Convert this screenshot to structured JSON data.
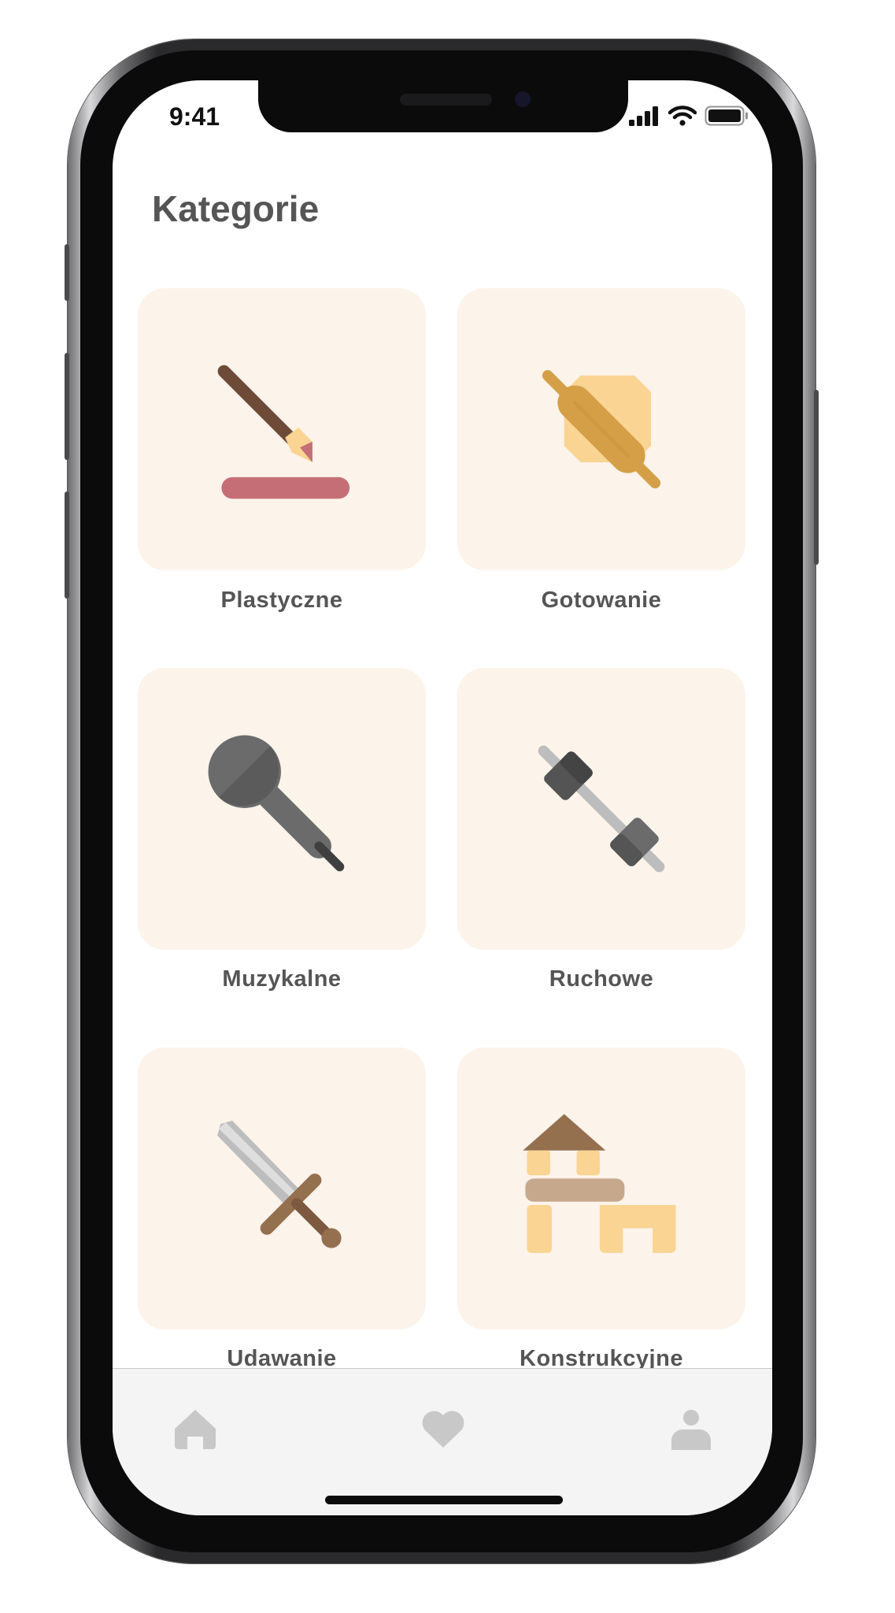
{
  "status_bar": {
    "time": "9:41"
  },
  "page": {
    "title": "Kategorie"
  },
  "categories": [
    {
      "label": "Plastyczne",
      "icon": "paintbrush-icon"
    },
    {
      "label": "Gotowanie",
      "icon": "rolling-pin-icon"
    },
    {
      "label": "Muzykalne",
      "icon": "microphone-icon"
    },
    {
      "label": "Ruchowe",
      "icon": "dumbbell-icon"
    },
    {
      "label": "Udawanie",
      "icon": "sword-icon"
    },
    {
      "label": "Konstrukcyjne",
      "icon": "building-blocks-icon"
    }
  ],
  "tab_bar": {
    "items": [
      {
        "icon": "home-icon"
      },
      {
        "icon": "heart-icon"
      },
      {
        "icon": "profile-icon"
      }
    ]
  },
  "colors": {
    "card_background": "#fcf3ea",
    "text": "#555555",
    "tab_icon": "#c8c8c8",
    "tab_bar_background": "#f4f4f4"
  }
}
